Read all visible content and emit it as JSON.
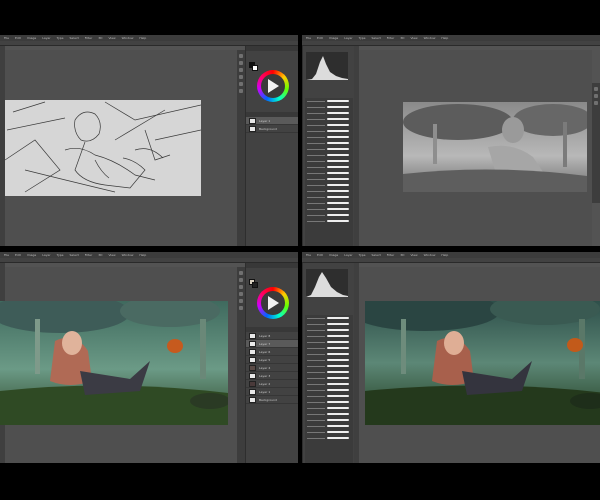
{
  "panes": [
    {
      "id": "tl",
      "stage": "sketch",
      "menu": [
        "File",
        "Edit",
        "Image",
        "Layer",
        "Type",
        "Select",
        "Filter",
        "3D",
        "View",
        "Window",
        "Help"
      ],
      "layers": [
        "Layer 1",
        "Background"
      ]
    },
    {
      "id": "tr",
      "stage": "grayscale",
      "menu": [
        "File",
        "Edit",
        "Image",
        "Layer",
        "Type",
        "Select",
        "Filter",
        "3D",
        "View",
        "Window",
        "Help"
      ]
    },
    {
      "id": "bl",
      "stage": "color",
      "menu": [
        "File",
        "Edit",
        "Image",
        "Layer",
        "Type",
        "Select",
        "Filter",
        "3D",
        "View",
        "Window",
        "Help"
      ],
      "layers": [
        "Layer 8",
        "Layer 7",
        "Layer 6",
        "Layer 5",
        "Layer 4",
        "Layer 3",
        "Layer 2",
        "Layer 1",
        "Background"
      ]
    },
    {
      "id": "br",
      "stage": "final",
      "menu": [
        "File",
        "Edit",
        "Image",
        "Layer",
        "Type",
        "Select",
        "Filter",
        "3D",
        "View",
        "Window",
        "Help"
      ]
    }
  ],
  "icons": {
    "color_wheel": "color-wheel-icon",
    "play": "play-triangle-icon",
    "brush": "brush-stroke-icon"
  },
  "colors": {
    "ui_bg": "#535353",
    "panel": "#424242",
    "menubar": "#3c3c3c",
    "outer_bg": "#000000"
  }
}
